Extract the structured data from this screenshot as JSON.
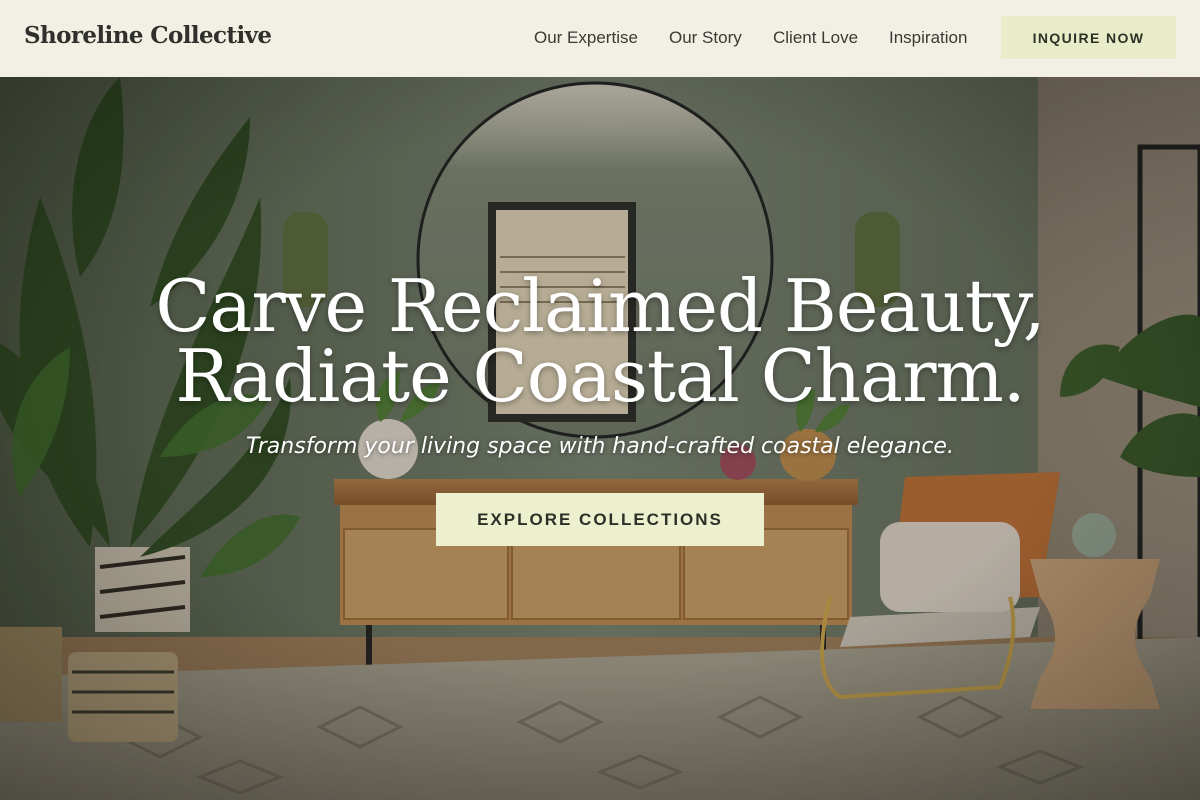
{
  "header": {
    "logo": "Shoreline Collective",
    "nav": [
      "Our Expertise",
      "Our Story",
      "Client Love",
      "Inspiration"
    ],
    "cta_label": "INQUIRE NOW"
  },
  "hero": {
    "headline_line1": "Carve Reclaimed Beauty,",
    "headline_line2": "Radiate Coastal Charm.",
    "subtitle": "Transform your living space with hand-crafted coastal elegance.",
    "cta_label": "EXPLORE COLLECTIONS",
    "background_description": "living-room-interior-photo"
  },
  "colors": {
    "header_bg": "#f2efe4",
    "cta_bg": "#e9ecc8",
    "wall": "#6f7a68",
    "text_dark": "#2f2f2c"
  }
}
